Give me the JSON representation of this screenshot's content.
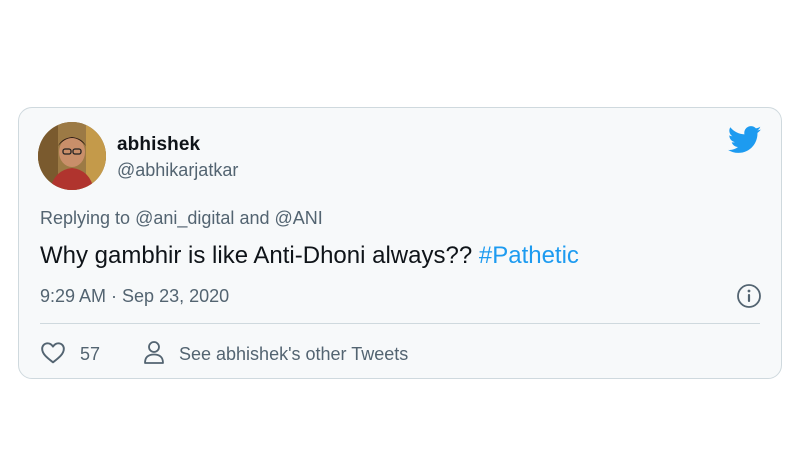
{
  "tweet": {
    "author": {
      "display_name": "abhishek",
      "handle": "@abhikarjatkar"
    },
    "reply": {
      "prefix": "Replying to",
      "mention_1": "@ani_digital",
      "joiner": "and",
      "mention_2": "@ANI"
    },
    "text": "Why gambhir is like Anti-Dhoni always??",
    "hashtag": "#Pathetic",
    "timestamp": "9:29 AM · Sep 23, 2020",
    "likes": "57",
    "profile_link_label": "See abhishek's other Tweets"
  },
  "colors": {
    "accent": "#1d9bf0",
    "text_primary": "#0f1419",
    "text_secondary": "#536471",
    "border": "#cfd9de",
    "card_bg": "#f7f9fa"
  },
  "icons": {
    "brand": "twitter-bird-icon",
    "info": "info-icon",
    "like": "heart-icon",
    "profile": "person-icon"
  }
}
